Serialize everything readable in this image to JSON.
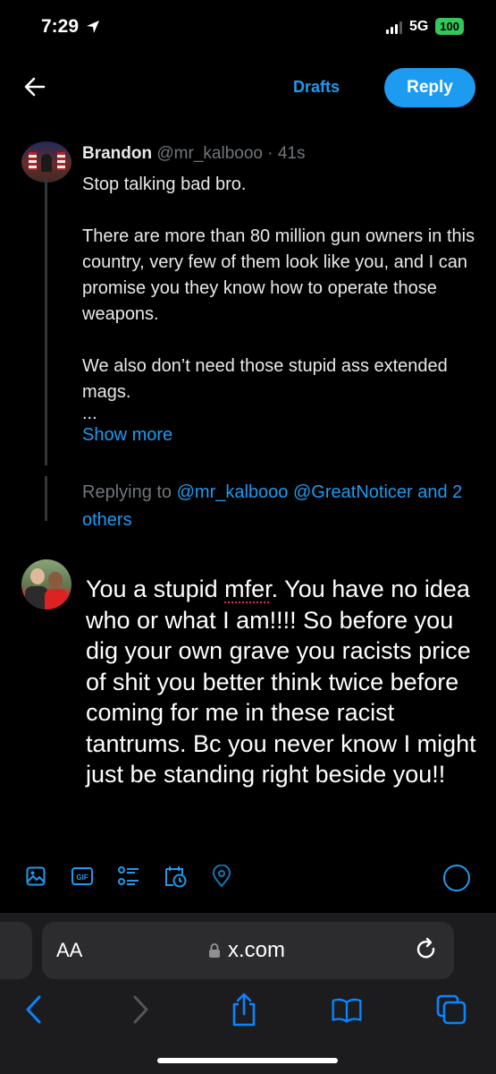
{
  "status_bar": {
    "time": "7:29",
    "network": "5G",
    "battery": "100"
  },
  "nav": {
    "drafts_label": "Drafts",
    "reply_label": "Reply"
  },
  "tweet": {
    "author_name": "Brandon",
    "author_handle": "@mr_kalbooo",
    "separator": "·",
    "time": "41s",
    "paragraphs": [
      "Stop talking bad bro.",
      "There are more than 80 million gun owners in this country, very few of them look like you, and I can promise you they know how to operate those weapons.",
      "We also don’t need those stupid ass extended mags."
    ],
    "ellipsis": "...",
    "show_more": "Show more"
  },
  "replying": {
    "prefix": "Replying to",
    "mention1": "@mr_kalbooo",
    "mention2": "@GreatNoticer",
    "others": "and 2 others"
  },
  "compose": {
    "before": "You a stupid ",
    "misspelled": "mfer",
    "after": ". You have no idea who or what I am!!!! So before you dig your own grave you racists price of shit you better think twice before coming for me in these racist tantrums. Bc you never know I might just be standing right beside you!!"
  },
  "toolbar_icons": [
    "image-icon",
    "gif-icon",
    "poll-icon",
    "schedule-icon",
    "location-icon"
  ],
  "safari": {
    "text_size_label": "AA",
    "url": "x.com"
  },
  "colors": {
    "accent": "#1d9bf0",
    "background": "#000000",
    "muted": "#71767b",
    "battery": "#34c759"
  }
}
